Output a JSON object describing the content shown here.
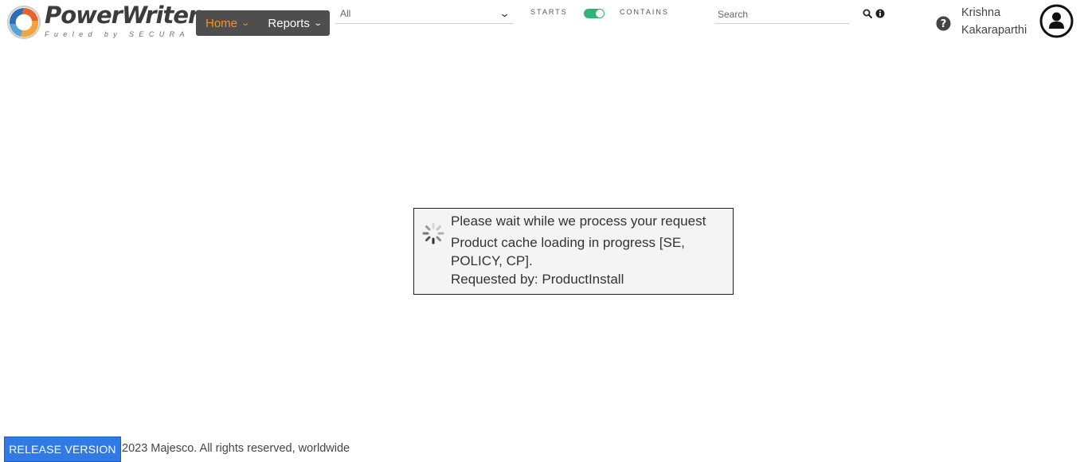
{
  "logo": {
    "brand": "PowerWriter",
    "tagline": "Fueled by SECURA"
  },
  "nav": {
    "items": [
      {
        "label": "Home",
        "active": true
      },
      {
        "label": "Reports",
        "active": false
      }
    ],
    "active_color": "#f7941d"
  },
  "filter": {
    "selected": "All"
  },
  "toggle": {
    "left_label": "STARTS",
    "right_label": "CONTAINS",
    "state": "contains",
    "color": "#2bb673"
  },
  "search": {
    "placeholder": "Search",
    "value": ""
  },
  "icons": {
    "search": "search-icon",
    "info": "info-icon",
    "help": "help-icon",
    "avatar": "user-avatar-icon",
    "spinner": "spinner-icon"
  },
  "user": {
    "first_name": "Krishna",
    "last_name": "Kakaraparthi"
  },
  "loading": {
    "line1": "Please wait while we process your request",
    "line2": "Product cache loading in progress [SE, POLICY, CP].",
    "line3": "Requested by: ProductInstall"
  },
  "footer": {
    "release_label": "RELEASE VERSION",
    "copyright": "2023 Majesco. All rights reserved, worldwide",
    "button_color": "#2f7ae5"
  }
}
